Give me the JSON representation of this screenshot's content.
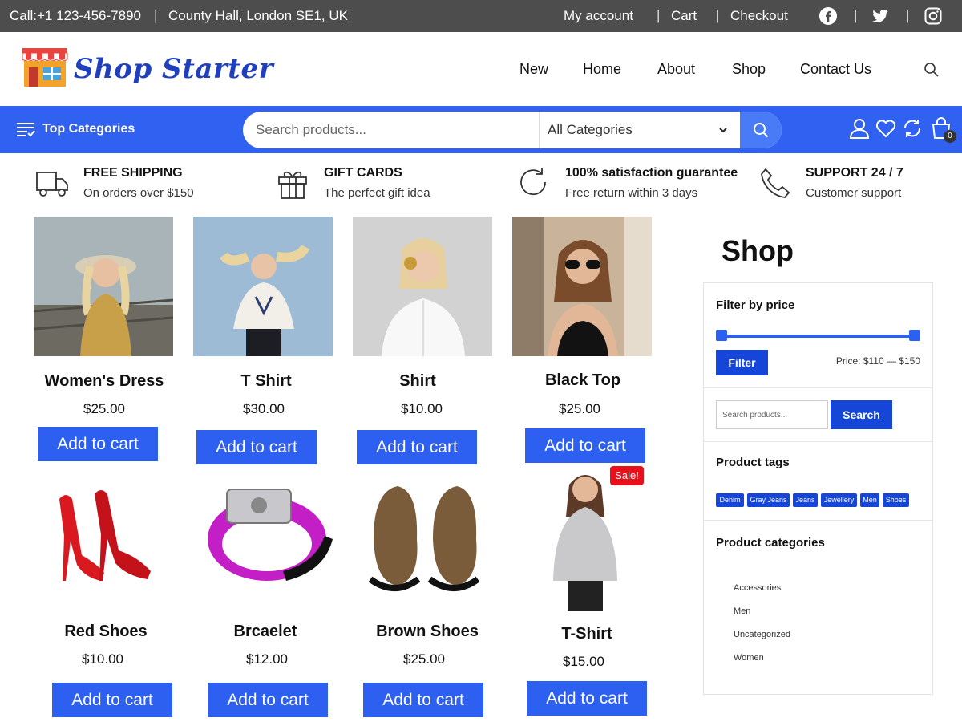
{
  "topbar": {
    "call": "Call:+1 123-456-7890",
    "address": "County Hall, London SE1, UK",
    "links": [
      "My account",
      "Cart",
      "Checkout"
    ],
    "social_icons": [
      "facebook-icon",
      "twitter-icon",
      "instagram-icon"
    ]
  },
  "header": {
    "logo_text": "Shop Starter",
    "nav": [
      "New",
      "Home",
      "About",
      "Shop",
      "Contact Us"
    ]
  },
  "catbar": {
    "top_categories": "Top Categories",
    "search_placeholder": "Search products...",
    "category_select": "All Categories",
    "cart_count": "0"
  },
  "features": [
    {
      "icon": "truck-icon",
      "title": "FREE SHIPPING",
      "sub": "On orders over $150"
    },
    {
      "icon": "gift-icon",
      "title": "GIFT CARDS",
      "sub": "The perfect gift idea"
    },
    {
      "icon": "refresh-icon",
      "title": "100% satisfaction guarantee",
      "sub": "Free return within 3 days"
    },
    {
      "icon": "phone-icon",
      "title": "SUPPORT 24 / 7",
      "sub": "Customer support"
    }
  ],
  "products": [
    {
      "name": "Women's Dress",
      "price": "$25.00",
      "button": "Add to cart"
    },
    {
      "name": "T Shirt",
      "price": "$30.00",
      "button": "Add to cart"
    },
    {
      "name": "Shirt",
      "price": "$10.00",
      "button": "Add to cart"
    },
    {
      "name": "Black Top",
      "price": "$25.00",
      "button": "Add to cart"
    },
    {
      "name": "Red Shoes",
      "price": "$10.00",
      "button": "Add to cart"
    },
    {
      "name": "Brcaelet",
      "price": "$12.00",
      "button": "Add to cart"
    },
    {
      "name": "Brown Shoes",
      "price": "$25.00",
      "button": "Add to cart"
    },
    {
      "name": "T-Shirt",
      "price": "$15.00",
      "button": "Add to cart",
      "badge": "Sale!"
    }
  ],
  "sidebar": {
    "title": "Shop",
    "filter_heading": "Filter by price",
    "filter_button": "Filter",
    "price_label": "Price: $110 — $150",
    "search_placeholder": "Search products...",
    "search_button": "Search",
    "tags_heading": "Product tags",
    "tags": [
      "Denim",
      "Gray Jeans",
      "Jeans",
      "Jewellery",
      "Men",
      "Shoes"
    ],
    "categories_heading": "Product categories",
    "categories": [
      "Accessories",
      "Men",
      "Uncategorized",
      "Women"
    ]
  },
  "colors": {
    "topbar_bg": "#4d4d4d",
    "accent_blue": "#3061f0",
    "button_blue": "#2d5ff0",
    "sale_red": "#e8101a"
  }
}
